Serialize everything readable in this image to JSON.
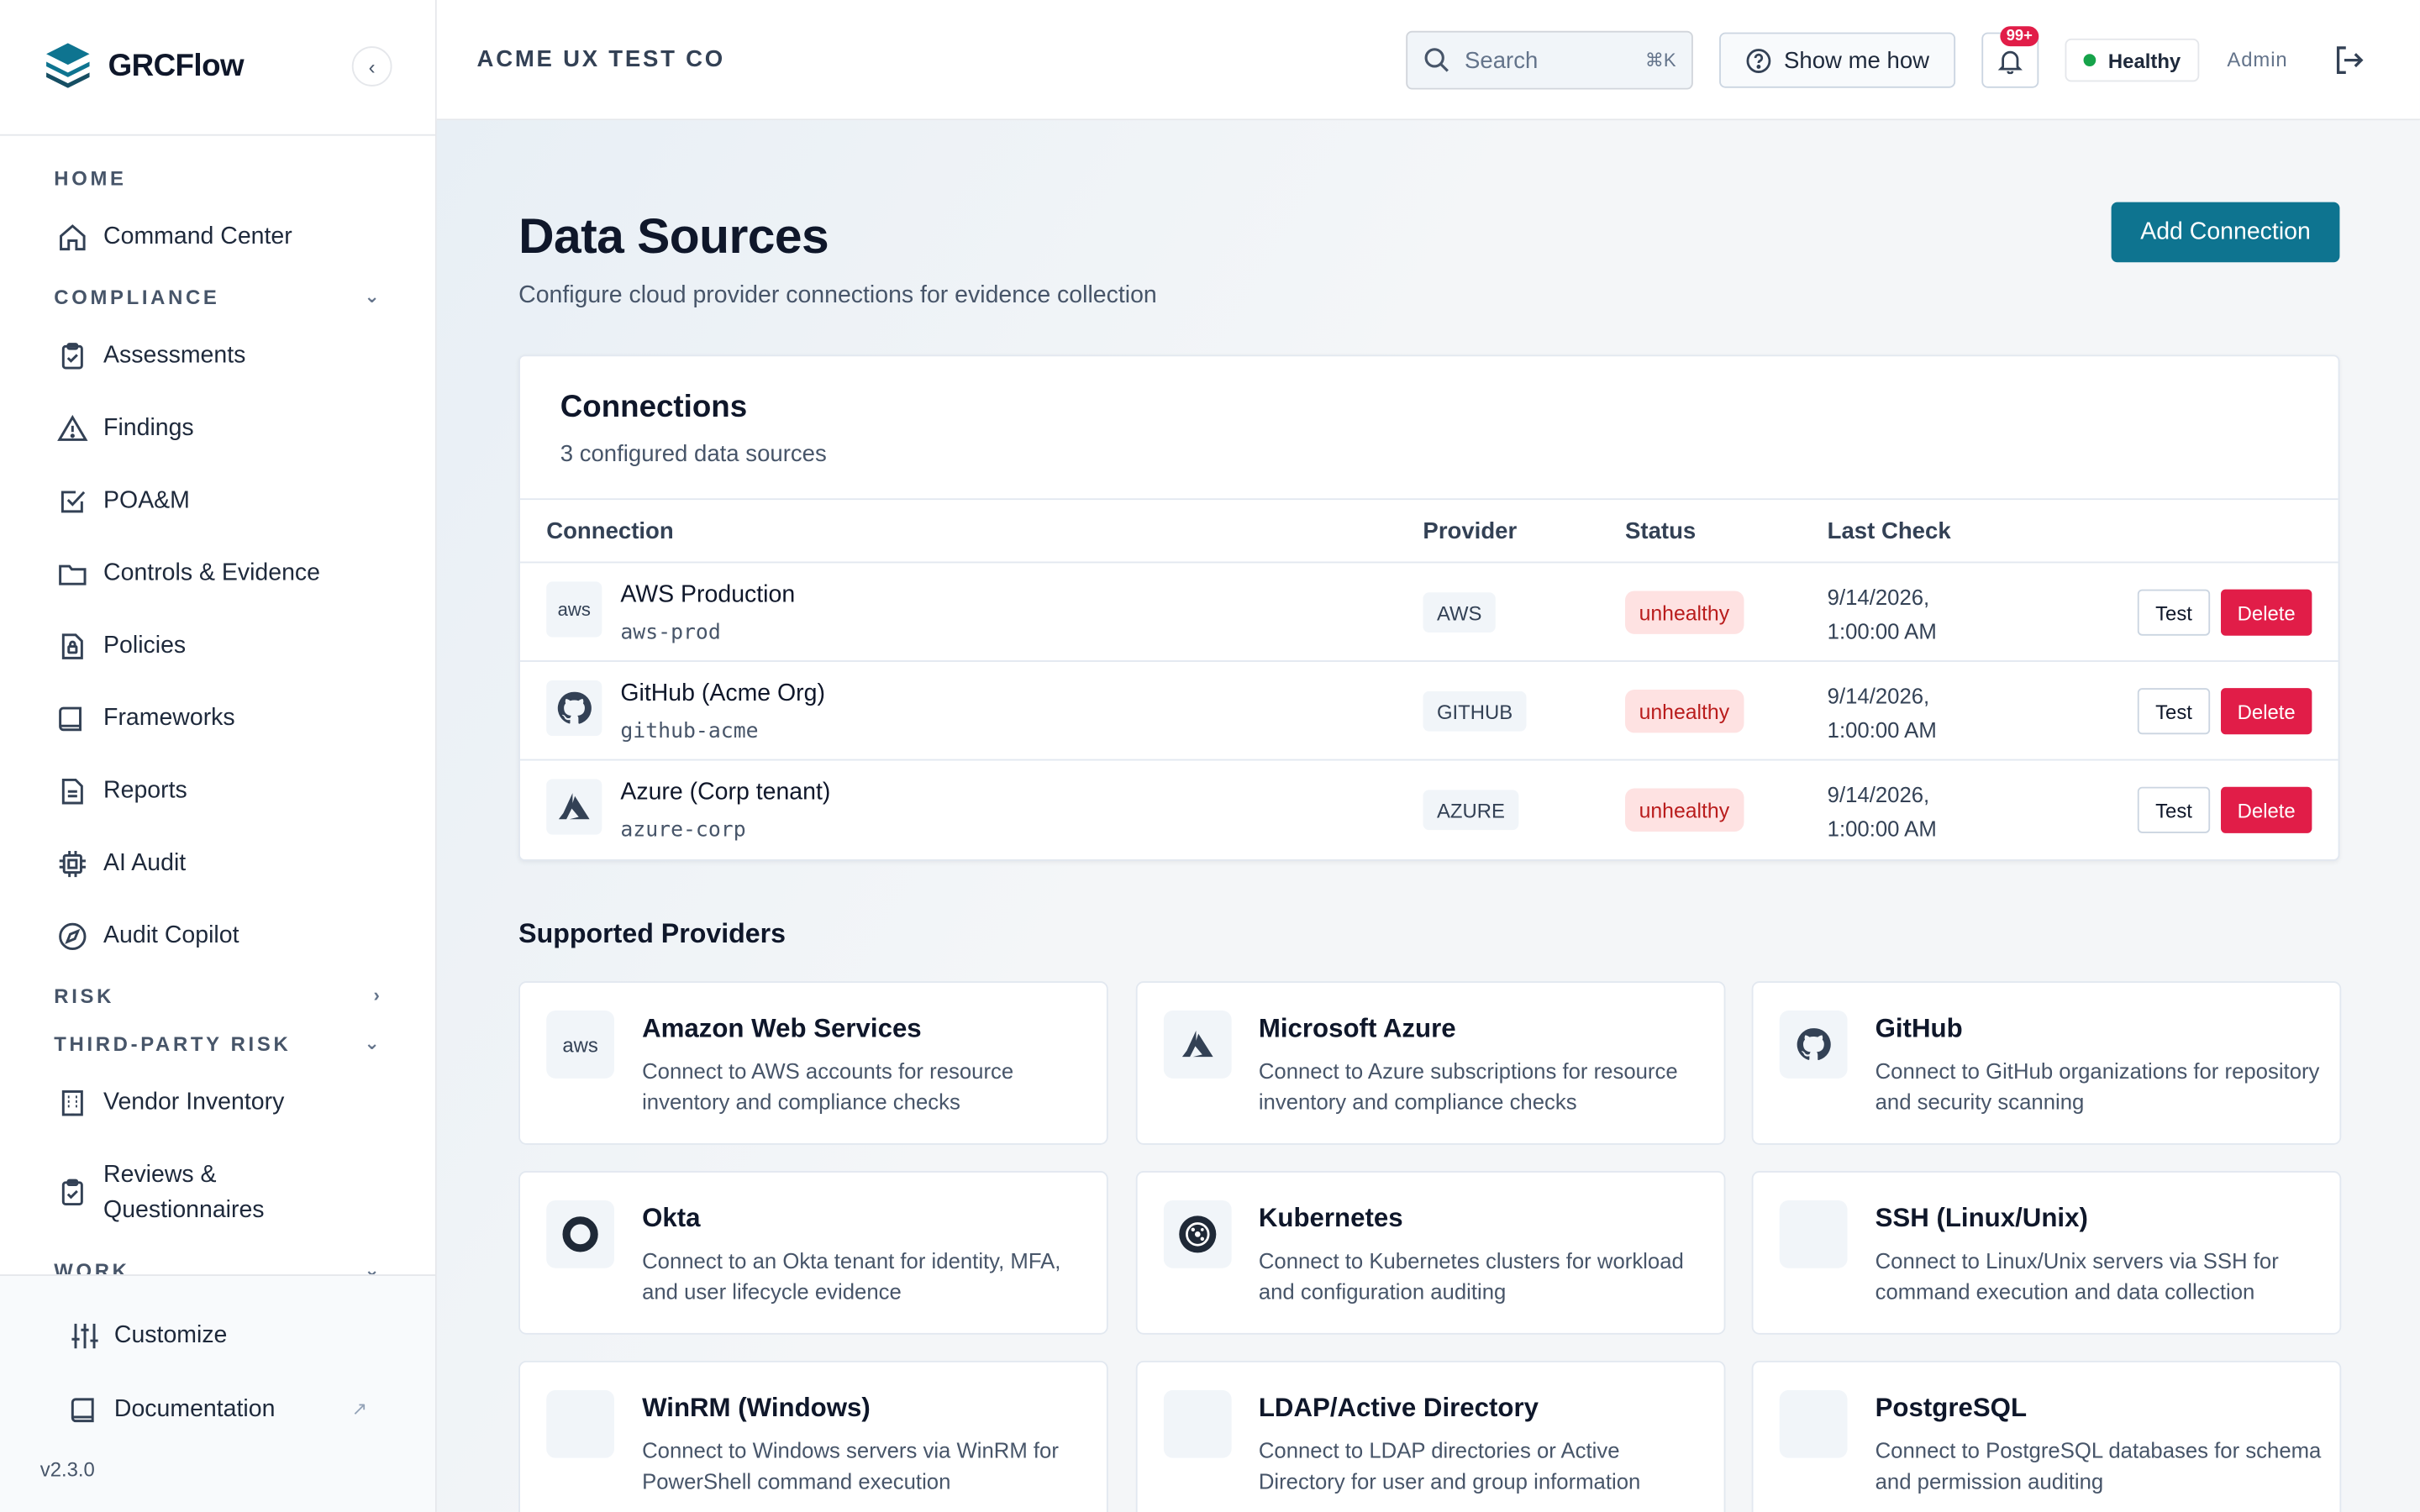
{
  "brand": {
    "name": "GRCFlow",
    "collapse_icon": "‹"
  },
  "sidebar": {
    "groups": [
      {
        "label": "HOME",
        "chevron": "",
        "items": [
          {
            "label": "Command Center",
            "icon": "home-icon"
          }
        ]
      },
      {
        "label": "COMPLIANCE",
        "chevron": "⌄",
        "items": [
          {
            "label": "Assessments",
            "icon": "clipboard-icon"
          },
          {
            "label": "Findings",
            "icon": "warning-icon"
          },
          {
            "label": "POA&M",
            "icon": "checkbox-icon"
          },
          {
            "label": "Controls & Evidence",
            "icon": "folder-icon"
          },
          {
            "label": "Policies",
            "icon": "policy-doc-icon"
          },
          {
            "label": "Frameworks",
            "icon": "book-icon"
          },
          {
            "label": "Reports",
            "icon": "document-icon"
          },
          {
            "label": "AI Audit",
            "icon": "chip-icon"
          },
          {
            "label": "Audit Copilot",
            "icon": "compass-icon"
          }
        ]
      },
      {
        "label": "RISK",
        "chevron": "›",
        "items": []
      },
      {
        "label": "THIRD-PARTY RISK",
        "chevron": "⌄",
        "items": [
          {
            "label": "Vendor Inventory",
            "icon": "building-icon"
          },
          {
            "label": "Reviews & Questionnaires",
            "icon": "clipboard-icon"
          }
        ]
      },
      {
        "label": "WORK",
        "chevron": "⌄",
        "items": []
      }
    ],
    "bottom": {
      "customize": "Customize",
      "documentation": "Documentation",
      "external_icon": "↗"
    },
    "version": "v2.3.0"
  },
  "header": {
    "org": "ACME UX TEST CO",
    "search_placeholder": "Search",
    "search_shortcut": "⌘K",
    "show_me_how": "Show me how",
    "notification_badge": "99+",
    "health": "Healthy",
    "user": "Admin"
  },
  "page": {
    "title": "Data Sources",
    "subtitle": "Configure cloud provider connections for evidence collection",
    "add_button": "Add Connection"
  },
  "connections": {
    "title": "Connections",
    "subtitle": "3 configured data sources",
    "columns": {
      "connection": "Connection",
      "provider": "Provider",
      "status": "Status",
      "last_check": "Last Check"
    },
    "test_label": "Test",
    "delete_label": "Delete",
    "rows": [
      {
        "name": "AWS Production",
        "id": "aws-prod",
        "provider": "AWS",
        "status": "unhealthy",
        "last_check": "9/14/2026, 1:00:00 AM",
        "icon": "aws-icon",
        "icon_text": "aws"
      },
      {
        "name": "GitHub (Acme Org)",
        "id": "github-acme",
        "provider": "GITHUB",
        "status": "unhealthy",
        "last_check": "9/14/2026, 1:00:00 AM",
        "icon": "github-icon",
        "icon_text": ""
      },
      {
        "name": "Azure (Corp tenant)",
        "id": "azure-corp",
        "provider": "AZURE",
        "status": "unhealthy",
        "last_check": "9/14/2026, 1:00:00 AM",
        "icon": "azure-icon",
        "icon_text": ""
      }
    ]
  },
  "providers": {
    "title": "Supported Providers",
    "items": [
      {
        "name": "Amazon Web Services",
        "desc": "Connect to AWS accounts for resource inventory and compliance checks",
        "icon": "aws-icon",
        "icon_text": "aws"
      },
      {
        "name": "Microsoft Azure",
        "desc": "Connect to Azure subscriptions for resource inventory and compliance checks",
        "icon": "azure-icon",
        "icon_text": ""
      },
      {
        "name": "GitHub",
        "desc": "Connect to GitHub organizations for repository and security scanning",
        "icon": "github-icon",
        "icon_text": ""
      },
      {
        "name": "Okta",
        "desc": "Connect to an Okta tenant for identity, MFA, and user lifecycle evidence",
        "icon": "okta-icon",
        "icon_text": ""
      },
      {
        "name": "Kubernetes",
        "desc": "Connect to Kubernetes clusters for workload and configuration auditing",
        "icon": "kubernetes-icon",
        "icon_text": ""
      },
      {
        "name": "SSH (Linux/Unix)",
        "desc": "Connect to Linux/Unix servers via SSH for command execution and data collection",
        "icon": "ssh-icon",
        "icon_text": ""
      },
      {
        "name": "WinRM (Windows)",
        "desc": "Connect to Windows servers via WinRM for PowerShell command execution",
        "icon": "winrm-icon",
        "icon_text": ""
      },
      {
        "name": "LDAP/Active Directory",
        "desc": "Connect to LDAP directories or Active Directory for user and group information",
        "icon": "ldap-icon",
        "icon_text": ""
      },
      {
        "name": "PostgreSQL",
        "desc": "Connect to PostgreSQL databases for schema and permission auditing",
        "icon": "postgresql-icon",
        "icon_text": ""
      }
    ]
  },
  "colors": {
    "accent": "#0e7490",
    "danger": "#e11d48",
    "status_bg": "#fee2e2",
    "healthy": "#16a34a"
  }
}
